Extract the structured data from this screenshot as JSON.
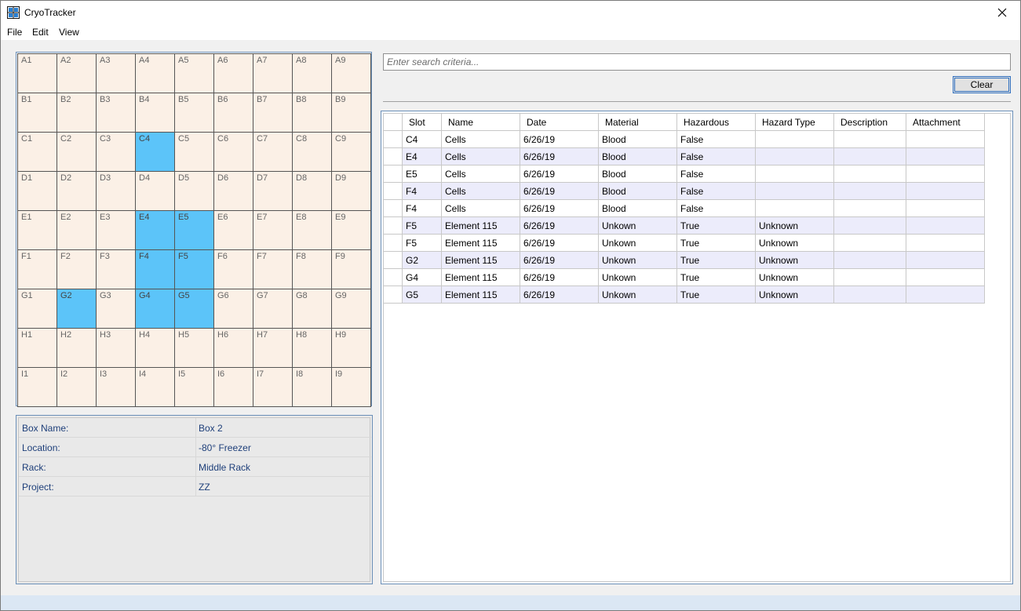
{
  "window": {
    "title": "CryoTracker"
  },
  "menu": [
    "File",
    "Edit",
    "View"
  ],
  "grid": {
    "rows": [
      "A",
      "B",
      "C",
      "D",
      "E",
      "F",
      "G",
      "H",
      "I"
    ],
    "cols": [
      "1",
      "2",
      "3",
      "4",
      "5",
      "6",
      "7",
      "8",
      "9"
    ],
    "selected": [
      "C4",
      "E4",
      "E5",
      "F4",
      "F5",
      "G2",
      "G4",
      "G5"
    ]
  },
  "box_info": [
    {
      "label": "Box Name:",
      "value": "Box 2"
    },
    {
      "label": "Location:",
      "value": "-80° Freezer"
    },
    {
      "label": "Rack:",
      "value": "Middle Rack"
    },
    {
      "label": "Project:",
      "value": "ZZ"
    }
  ],
  "search": {
    "placeholder": "Enter search criteria..."
  },
  "clear_label": "Clear",
  "table": {
    "columns": [
      "Slot",
      "Name",
      "Date",
      "Material",
      "Hazardous",
      "Hazard Type",
      "Description",
      "Attachment"
    ],
    "rows": [
      [
        "C4",
        "Cells",
        "6/26/19",
        "Blood",
        "False",
        "",
        "",
        ""
      ],
      [
        "E4",
        "Cells",
        "6/26/19",
        "Blood",
        "False",
        "",
        "",
        ""
      ],
      [
        "E5",
        "Cells",
        "6/26/19",
        "Blood",
        "False",
        "",
        "",
        ""
      ],
      [
        "F4",
        "Cells",
        "6/26/19",
        "Blood",
        "False",
        "",
        "",
        ""
      ],
      [
        "F4",
        "Cells",
        "6/26/19",
        "Blood",
        "False",
        "",
        "",
        ""
      ],
      [
        "F5",
        "Element 115",
        "6/26/19",
        "Unkown",
        "True",
        "Unknown",
        "",
        ""
      ],
      [
        "F5",
        "Element 115",
        "6/26/19",
        "Unkown",
        "True",
        "Unknown",
        "",
        ""
      ],
      [
        "G2",
        "Element 115",
        "6/26/19",
        "Unkown",
        "True",
        "Unknown",
        "",
        ""
      ],
      [
        "G4",
        "Element 115",
        "6/26/19",
        "Unkown",
        "True",
        "Unknown",
        "",
        ""
      ],
      [
        "G5",
        "Element 115",
        "6/26/19",
        "Unkown",
        "True",
        "Unknown",
        "",
        ""
      ]
    ]
  },
  "colors": {
    "selected": "#5cc4f9",
    "cell": "#fbf0e6",
    "alt_row": "#ececfb"
  }
}
